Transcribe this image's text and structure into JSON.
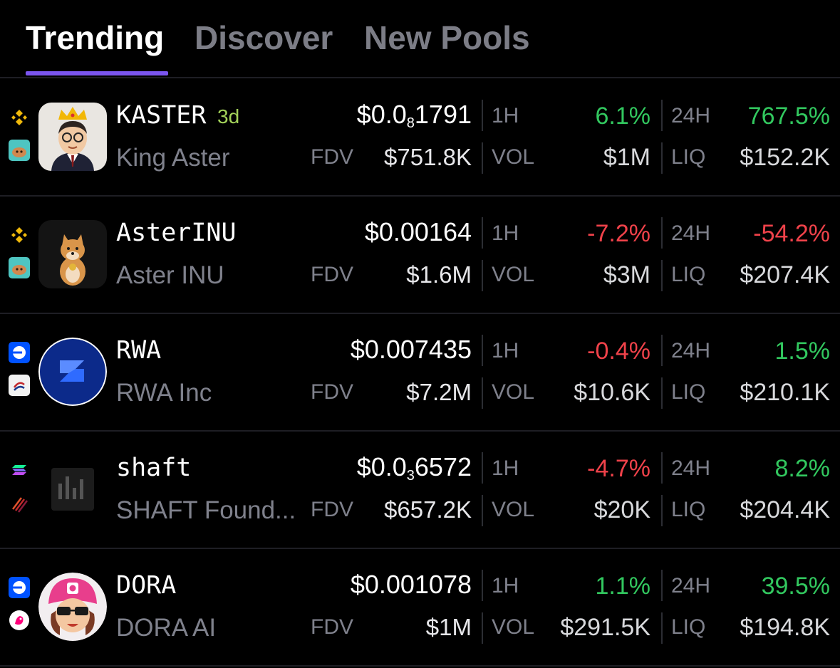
{
  "tabs": [
    "Trending",
    "Discover",
    "New Pools"
  ],
  "labels": {
    "fdv": "FDV",
    "h1": "1H",
    "vol": "VOL",
    "h24": "24H",
    "liq": "LIQ"
  },
  "rows": [
    {
      "symbol": "KASTER",
      "age": "3d",
      "name": "King Aster",
      "price_prefix": "$0.0",
      "price_sub": "8",
      "price_rest": "1791",
      "fdv": "$751.8K",
      "change_1h": "6.1%",
      "change_1h_dir": "up",
      "vol": "$1M",
      "change_24h": "767.5%",
      "change_24h_dir": "up",
      "liq": "$152.2K",
      "chains": [
        "bnb-icon",
        "pancakeswap-icon"
      ]
    },
    {
      "symbol": "AsterINU",
      "age": "",
      "name": "Aster INU",
      "price_prefix": "$0.00164",
      "price_sub": "",
      "price_rest": "",
      "fdv": "$1.6M",
      "change_1h": "-7.2%",
      "change_1h_dir": "down",
      "vol": "$3M",
      "change_24h": "-54.2%",
      "change_24h_dir": "down",
      "liq": "$207.4K",
      "chains": [
        "bnb-icon",
        "pancakeswap-icon"
      ]
    },
    {
      "symbol": "RWA",
      "age": "",
      "name": "RWA Inc",
      "price_prefix": "$0.007435",
      "price_sub": "",
      "price_rest": "",
      "fdv": "$7.2M",
      "change_1h": "-0.4%",
      "change_1h_dir": "down",
      "vol": "$10.6K",
      "change_24h": "1.5%",
      "change_24h_dir": "up",
      "liq": "$210.1K",
      "chains": [
        "base-icon",
        "dex-icon"
      ]
    },
    {
      "symbol": "shaft",
      "age": "",
      "name": "SHAFT Found...",
      "price_prefix": "$0.0",
      "price_sub": "3",
      "price_rest": "6572",
      "fdv": "$657.2K",
      "change_1h": "-4.7%",
      "change_1h_dir": "down",
      "vol": "$20K",
      "change_24h": "8.2%",
      "change_24h_dir": "up",
      "liq": "$204.4K",
      "chains": [
        "solana-icon",
        "meteora-icon"
      ]
    },
    {
      "symbol": "DORA",
      "age": "",
      "name": "DORA AI",
      "price_prefix": "$0.001078",
      "price_sub": "",
      "price_rest": "",
      "fdv": "$1M",
      "change_1h": "1.1%",
      "change_1h_dir": "up",
      "vol": "$291.5K",
      "change_24h": "39.5%",
      "change_24h_dir": "up",
      "liq": "$194.8K",
      "chains": [
        "base-icon",
        "uniswap-icon"
      ]
    }
  ]
}
